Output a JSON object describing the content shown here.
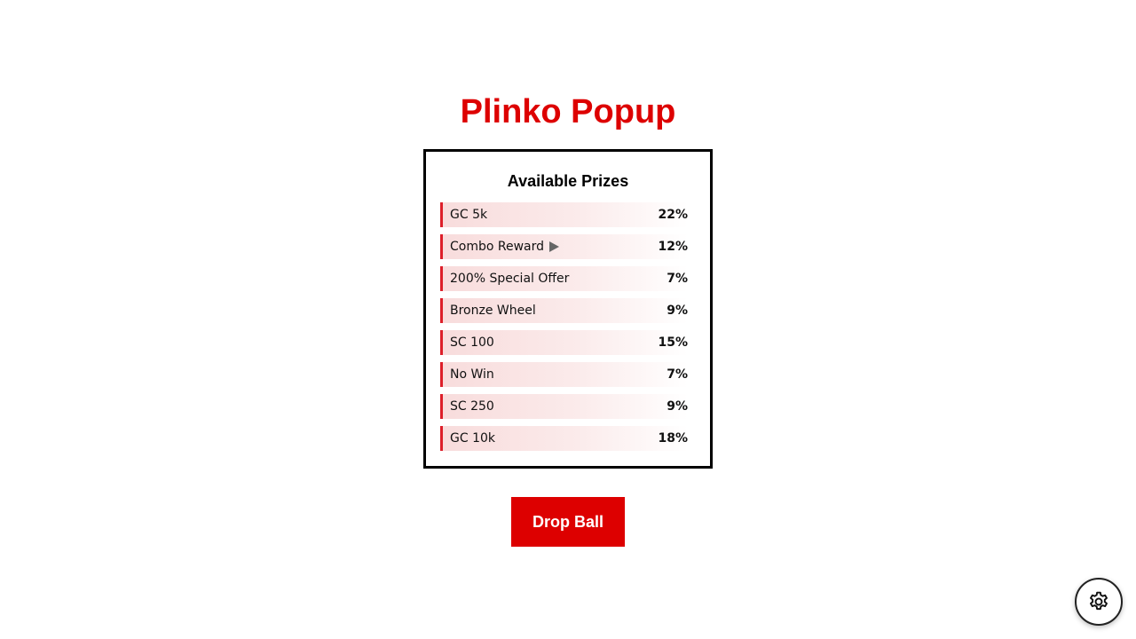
{
  "page": {
    "title": "Plinko Popup"
  },
  "prizes": {
    "heading": "Available Prizes",
    "items": [
      {
        "label": "GC 5k",
        "percent": "22%"
      },
      {
        "label": "Combo Reward",
        "percent": "12%",
        "icon": "play-icon"
      },
      {
        "label": "200% Special Offer",
        "percent": "7%"
      },
      {
        "label": "Bronze Wheel",
        "percent": "9%"
      },
      {
        "label": "SC 100",
        "percent": "15%"
      },
      {
        "label": "No Win",
        "percent": "7%"
      },
      {
        "label": "SC 250",
        "percent": "9%"
      },
      {
        "label": "GC 10k",
        "percent": "18%"
      }
    ]
  },
  "actions": {
    "drop_label": "Drop Ball"
  },
  "settings": {
    "icon": "gear-icon"
  },
  "colors": {
    "accent": "#dd0000",
    "row_border": "#dd1f2a",
    "row_tint": "#f8dcdc",
    "panel_border": "#000000"
  }
}
